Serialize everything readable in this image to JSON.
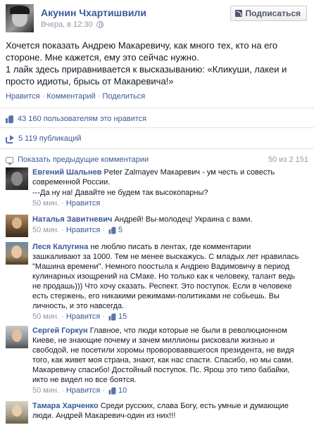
{
  "post": {
    "author": "Акунин Чхартишвили",
    "time": "Вчера, в 12:30",
    "subscribe_label": "Подписаться",
    "text_lines": [
      "Хочется показать Андрею Макаревичу, как много тех, кто на его",
      "стороне. Мне кажется, ему это сейчас нужно.",
      "1 лайк здесь приравнивается к высказыванию: «Кликуши, лакеи и",
      "просто идиоты, брысь от Макаревича!»"
    ],
    "actions": {
      "like": "Нравится",
      "comment": "Комментарий",
      "share": "Поделиться",
      "sep": "·"
    },
    "likes_text": "43 160 пользователям это нравится",
    "shares_text": "5 119 публикаций"
  },
  "comments_header": {
    "show_previous": "Показать предыдущие комментарии",
    "count": "50 из 2 151"
  },
  "comments": [
    {
      "name": "Евгений Шальнев",
      "lines": [
        "Peter Zalmayev Макаревич - ум честь и совесть",
        "современной России.",
        "---Да ну на! Давайте не будем так высокопарны?"
      ],
      "time": "50 мин.",
      "like": "Нравится",
      "likes": ""
    },
    {
      "name": "Наталья Завитневич",
      "lines": [
        "Андрей! Вы-молодец! Украина с вами."
      ],
      "time": "50 мин.",
      "like": "Нравится",
      "likes": "5"
    },
    {
      "name": "Леся Калугина",
      "lines": [
        "не люблю писать в лентах, где комментарии",
        "зашкаливают за 1000. Тем не менее выскажусь. С младых лет нравилась",
        "\"Машина времени\". Немного поостыла к Андрею Вадимовичу в период",
        "кулинарных изощрений на СМаке. Но только как к человеку, талант ведь",
        "не продашь))) Что хочу сказать. Респект. Это поступок. Если в человеке",
        "есть стержень, его никакими режимами-политиками не собьешь. Вы",
        "личность, и это навсегда."
      ],
      "time": "50 мин.",
      "like": "Нравится",
      "likes": "15"
    },
    {
      "name": "Сергей Горкун",
      "lines": [
        "Главное, что люди которые не были в революционном",
        "Киеве, не знающие почему и зачем миллионы рисковали жизнью и",
        "свободой, не посетили хоромы провороваввшегося президента, не видя",
        "того, как живет моя страна, знают, как нас спасти. Спасибо, но мы сами.",
        "Макаревичу спасибо! Достойный поступок. Пс. Ярош это типо бабайки,",
        "икто не видел но все боятся."
      ],
      "time": "50 мин.",
      "like": "Нравится",
      "likes": "10"
    },
    {
      "name": "Тамара Харченко",
      "lines": [
        "Среди русских, слава Богу, есть умные и думающие",
        "люди. Андрей Макаревич-один из них!!!"
      ],
      "time": "",
      "like": "",
      "likes": ""
    }
  ],
  "colors": {
    "link": "#3b5998",
    "meta": "#9197a3",
    "text": "#141823",
    "divider": "#e1e2e3"
  }
}
